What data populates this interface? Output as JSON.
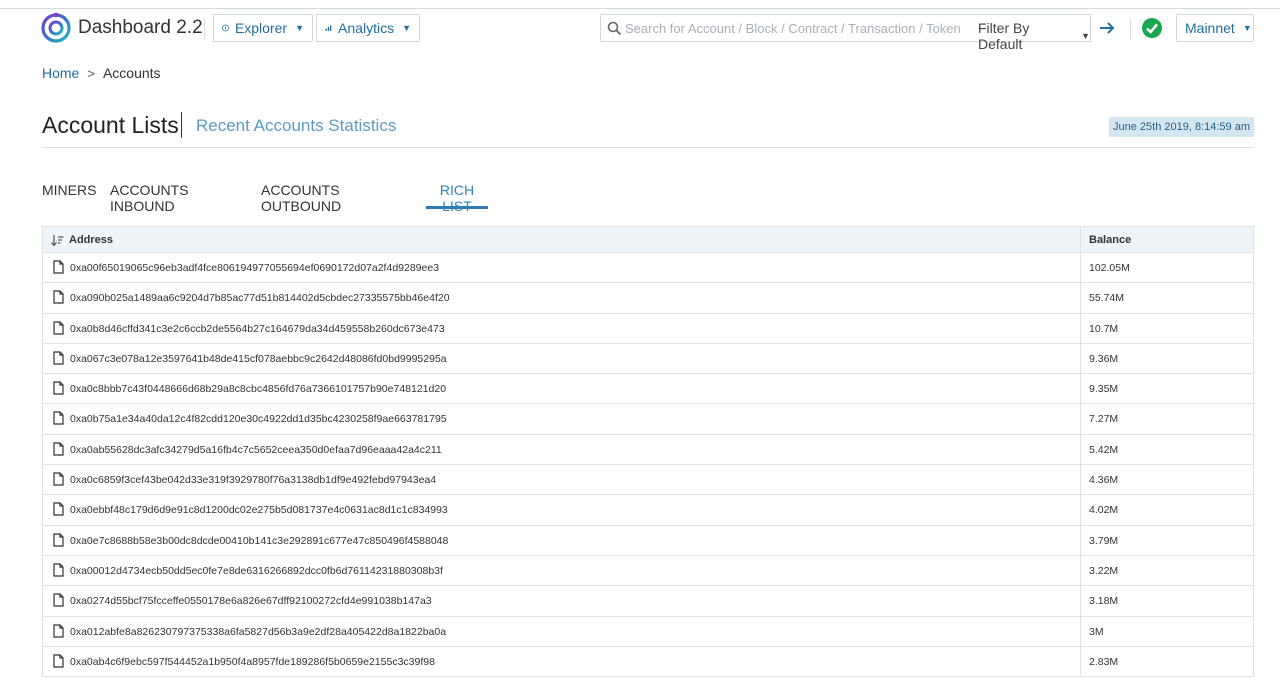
{
  "header": {
    "app_title": "Dashboard 2.2",
    "explorer_label": "Explorer",
    "analytics_label": "Analytics",
    "search_placeholder": "Search for Account / Block / Contract / Transaction / Token",
    "filter_label": "Filter By Default",
    "network_label": "Mainnet",
    "accent_color": "#1f6fa0",
    "status_color": "#1aa84f"
  },
  "breadcrumb": {
    "home": "Home",
    "current": "Accounts"
  },
  "page": {
    "title": "Account Lists",
    "subtitle": "Recent Accounts Statistics",
    "timestamp": "June 25th 2019, 8:14:59 am"
  },
  "tabs": [
    {
      "label": "MINERS",
      "active": false
    },
    {
      "label": "ACCOUNTS INBOUND",
      "active": false
    },
    {
      "label": "ACCOUNTS OUTBOUND",
      "active": false
    },
    {
      "label": "RICH LIST",
      "active": true
    }
  ],
  "table": {
    "columns": {
      "address": "Address",
      "balance": "Balance"
    },
    "rows": [
      {
        "address": "0xa00f65019065c96eb3adf4fce806194977055694ef0690172d07a2f4d9289ee3",
        "balance": "102.05M"
      },
      {
        "address": "0xa090b025a1489aa6c9204d7b85ac77d51b814402d5cbdec27335575bb46e4f20",
        "balance": "55.74M"
      },
      {
        "address": "0xa0b8d46cffd341c3e2c6ccb2de5564b27c164679da34d459558b260dc673e473",
        "balance": "10.7M"
      },
      {
        "address": "0xa067c3e078a12e3597641b48de415cf078aebbc9c2642d48086fd0bd9995295a",
        "balance": "9.36M"
      },
      {
        "address": "0xa0c8bbb7c43f0448666d68b29a8c8cbc4856fd76a7366101757b90e748121d20",
        "balance": "9.35M"
      },
      {
        "address": "0xa0b75a1e34a40da12c4f82cdd120e30c4922dd1d35bc4230258f9ae663781795",
        "balance": "7.27M"
      },
      {
        "address": "0xa0ab55628dc3afc34279d5a16fb4c7c5652ceea350d0efaa7d96eaaa42a4c211",
        "balance": "5.42M"
      },
      {
        "address": "0xa0c6859f3cef43be042d33e319f3929780f76a3138db1df9e492febd97943ea4",
        "balance": "4.36M"
      },
      {
        "address": "0xa0ebbf48c179d6d9e91c8d1200dc02e275b5d081737e4c0631ac8d1c1c834993",
        "balance": "4.02M"
      },
      {
        "address": "0xa0e7c8688b58e3b00dc8dcde00410b141c3e292891c677e47c850496f4588048",
        "balance": "3.79M"
      },
      {
        "address": "0xa00012d4734ecb50dd5ec0fe7e8de6316266892dcc0fb6d76114231880308b3f",
        "balance": "3.22M"
      },
      {
        "address": "0xa0274d55bcf75fcceffe0550178e6a826e67dff92100272cfd4e991038b147a3",
        "balance": "3.18M"
      },
      {
        "address": "0xa012abfe8a826230797375338a6fa5827d56b3a9e2df28a405422d8a1822ba0a",
        "balance": "3M"
      },
      {
        "address": "0xa0ab4c6f9ebc597f544452a1b950f4a8957fde189286f5b0659e2155c3c39f98",
        "balance": "2.83M"
      }
    ]
  }
}
